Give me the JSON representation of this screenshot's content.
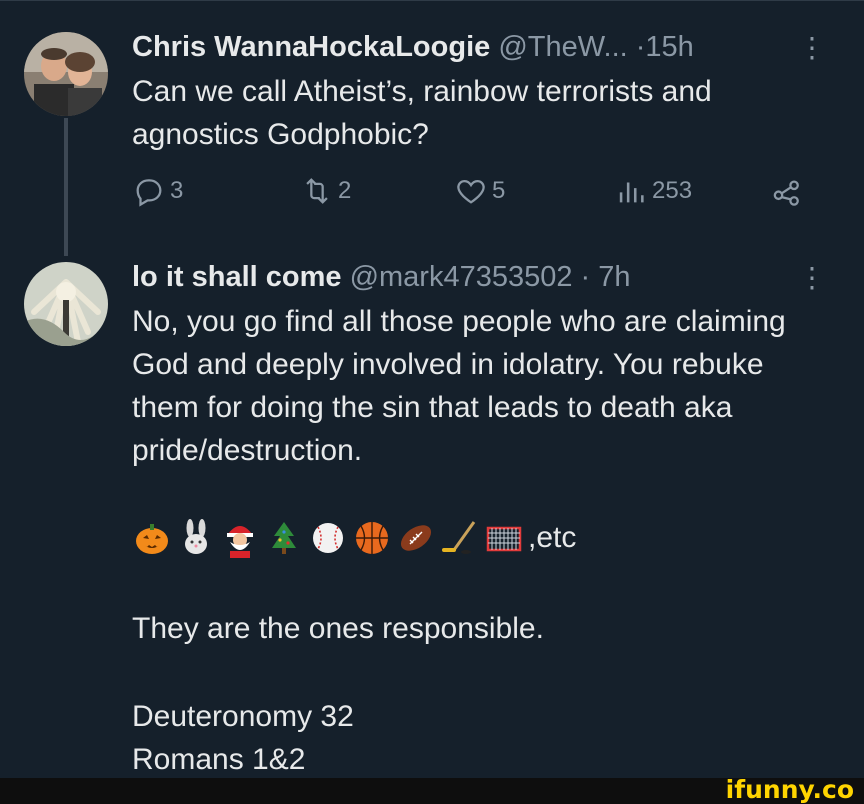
{
  "tweets": [
    {
      "name": "Chris WannaHockaLoogie",
      "handle": "@TheW...",
      "dot": "·",
      "time": "15h",
      "text": "Can we call Atheist’s, rainbow terrorists and agnostics Godphobic?",
      "actions": {
        "replies": "3",
        "reposts": "2",
        "likes": "5",
        "views": "253"
      }
    },
    {
      "name": "lo it shall come",
      "handle": "@mark47353502",
      "dot": "·",
      "time": "7h",
      "text": "No, you go find all those people who are claiming God and deeply involved in idolatry. You rebuke them for doing the sin that leads to death aka pride/destruction.",
      "emoji_suffix": ",etc",
      "text2": "They are the ones responsible.",
      "text3": "Deuteronomy 32",
      "text4": "Romans 1&2"
    }
  ],
  "watermark": "ifunny.co",
  "colors": {
    "background": "#15202b",
    "text": "#e7e9ea",
    "secondary": "#8b98a5",
    "watermark": "#ffd400"
  }
}
